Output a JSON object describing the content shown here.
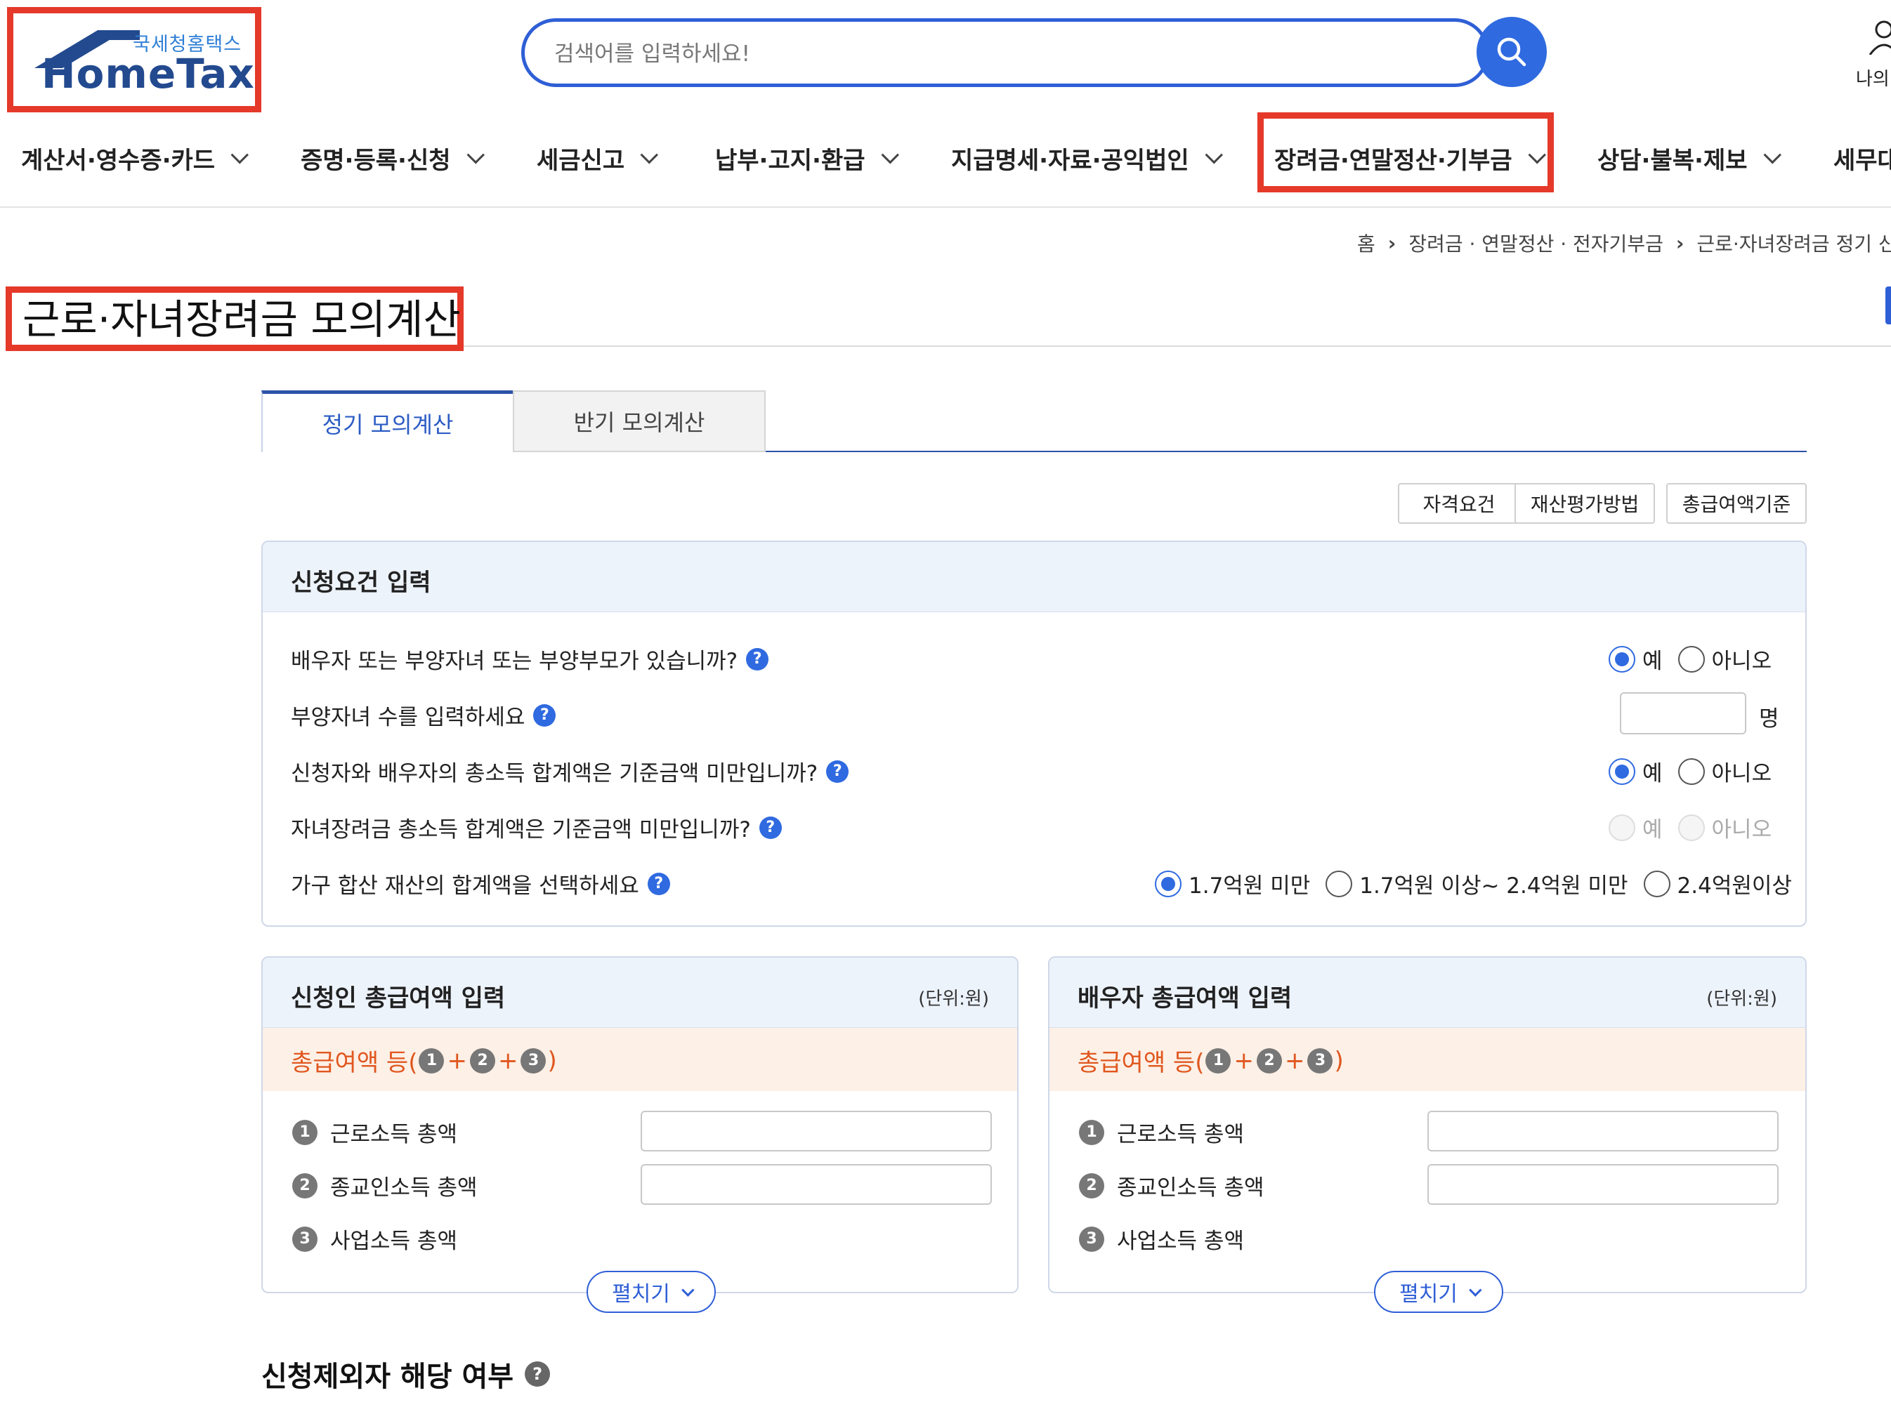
{
  "header": {
    "logo_sub": "국세청홈택스",
    "logo_main": "HomeTax",
    "search_placeholder": "검색어를 입력하세요!",
    "my_label": "나의"
  },
  "gnb": [
    {
      "label": "계산서·영수증·카드"
    },
    {
      "label": "증명·등록·신청"
    },
    {
      "label": "세금신고"
    },
    {
      "label": "납부·고지·환급"
    },
    {
      "label": "지급명세·자료·공익법인"
    },
    {
      "label": "장려금·연말정산·기부금"
    },
    {
      "label": "상담·불복·제보"
    },
    {
      "label": "세무대"
    }
  ],
  "breadcrumb": [
    "홈",
    "장려금 · 연말정산 · 전자기부금",
    "근로·자녀장려금 정기 신"
  ],
  "page_title": "근로·자녀장려금 모의계산",
  "tabs": [
    {
      "label": "정기 모의계산",
      "active": true
    },
    {
      "label": "반기 모의계산",
      "active": false
    }
  ],
  "buttons": {
    "eligibility": "자격요건",
    "asset_method": "재산평가방법",
    "gross_salary_criteria": "총급여액기준"
  },
  "requirements": {
    "title": "신청요건 입력",
    "questions": [
      {
        "text": "배우자 또는 부양자녀 또는 부양부모가 있습니까?",
        "options": [
          "예",
          "아니오"
        ],
        "selected": "예"
      },
      {
        "text": "부양자녀 수를 입력하세요",
        "value": "",
        "unit": "명"
      },
      {
        "text": "신청자와 배우자의 총소득 합계액은 기준금액 미만입니까?",
        "options": [
          "예",
          "아니오"
        ],
        "selected": "예"
      },
      {
        "text": "자녀장려금 총소득 합계액은 기준금액 미만입니까?",
        "options": [
          "예",
          "아니오"
        ],
        "selected": "",
        "disabled": true
      },
      {
        "text": "가구 합산 재산의 합계액을 선택하세요",
        "options": [
          "1.7억원 미만",
          "1.7억원 이상~ 2.4억원 미만",
          "2.4억원이상"
        ],
        "selected": "1.7억원 미만"
      }
    ]
  },
  "applicant": {
    "title": "신청인 총급여액 입력",
    "unit": "(단위:원)",
    "salary_label": "총급여액 등(",
    "salary_close": ")",
    "items": [
      {
        "num": "1",
        "label": "근로소득 총액",
        "value": ""
      },
      {
        "num": "2",
        "label": "종교인소득 총액",
        "value": ""
      },
      {
        "num": "3",
        "label": "사업소득 총액"
      }
    ],
    "expand": "펼치기"
  },
  "spouse": {
    "title": "배우자 총급여액 입력",
    "unit": "(단위:원)",
    "salary_label": "총급여액 등(",
    "salary_close": ")",
    "items": [
      {
        "num": "1",
        "label": "근로소득 총액",
        "value": ""
      },
      {
        "num": "2",
        "label": "종교인소득 총액",
        "value": ""
      },
      {
        "num": "3",
        "label": "사업소득 총액"
      }
    ],
    "expand": "펼치기"
  },
  "exclusion": {
    "title": "신청제외자 해당 여부"
  },
  "colors": {
    "accent": "#2f6ae0",
    "highlight": "#e5392a",
    "salary": "#e0571f"
  }
}
